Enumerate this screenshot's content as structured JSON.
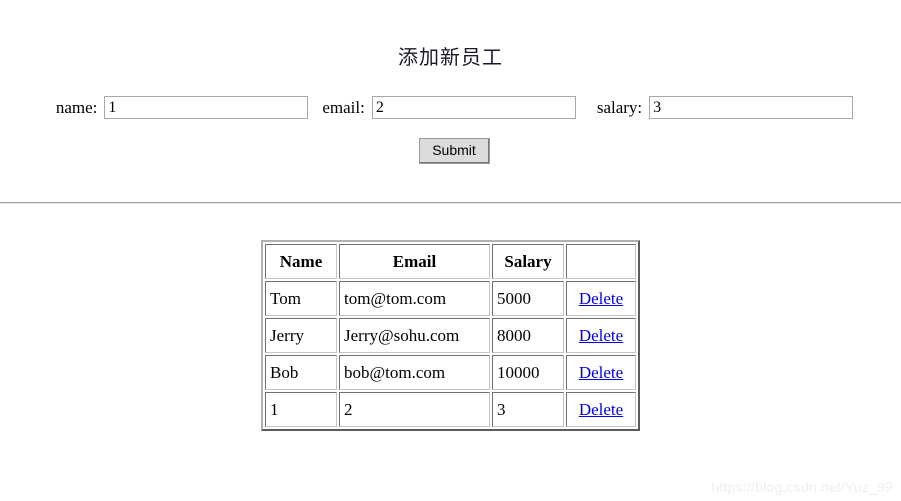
{
  "page": {
    "title": "添加新员工",
    "watermark": "https://blog.csdn.net/Yuz_99",
    "link_color": "#0000EE",
    "text_color": "#000000",
    "background": "#FFFFFF"
  },
  "form": {
    "fields": [
      {
        "label": "name:",
        "value": "1",
        "placeholder": ""
      },
      {
        "label": "email:",
        "value": "2",
        "placeholder": ""
      },
      {
        "label": "salary:",
        "value": "3",
        "placeholder": ""
      }
    ],
    "submit_label": "Submit"
  },
  "table": {
    "headers": [
      "Name",
      "Email",
      "Salary",
      ""
    ],
    "rows": [
      {
        "name": "Tom",
        "email": "tom@tom.com",
        "salary": "5000",
        "action": "Delete"
      },
      {
        "name": "Jerry",
        "email": "Jerry@sohu.com",
        "salary": "8000",
        "action": "Delete"
      },
      {
        "name": "Bob",
        "email": "bob@tom.com",
        "salary": "10000",
        "action": "Delete"
      },
      {
        "name": "1",
        "email": "2",
        "salary": "3",
        "action": "Delete"
      }
    ]
  }
}
